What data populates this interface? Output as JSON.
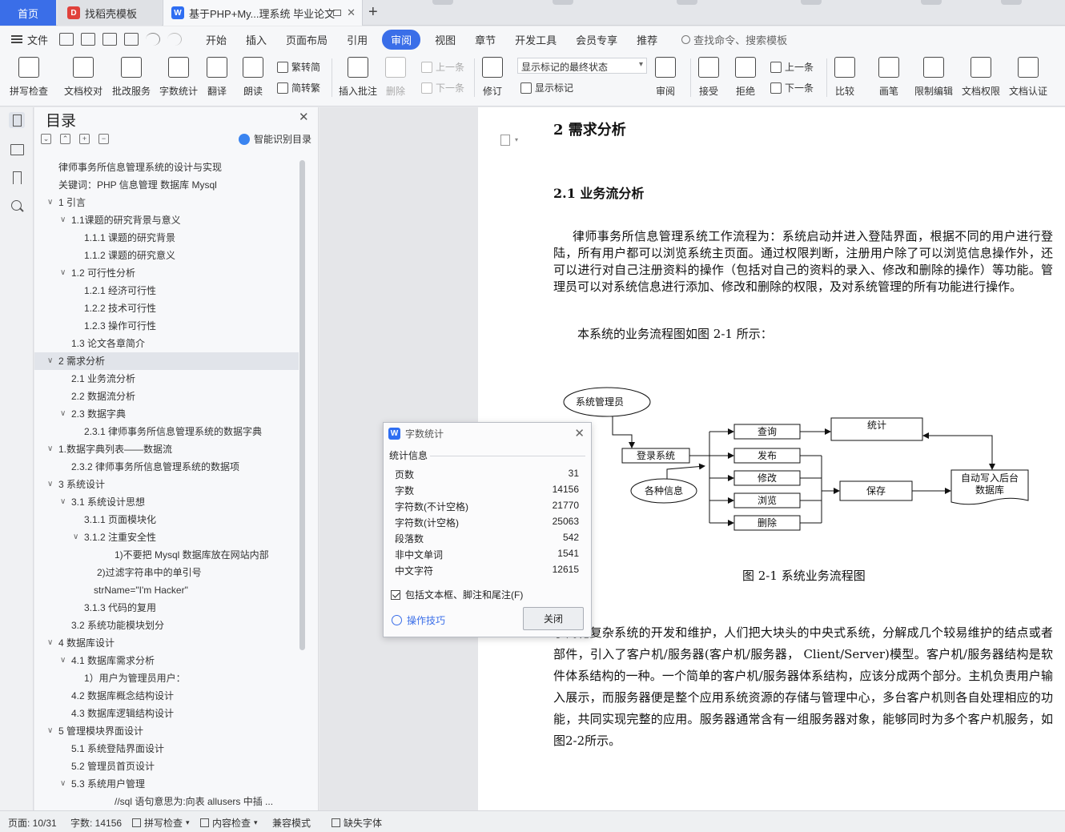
{
  "tabs": {
    "home": "首页",
    "daoke": "找稻壳模板",
    "doc": "基于PHP+My...理系统 毕业论文"
  },
  "menu": {
    "file": "文件",
    "items": [
      "开始",
      "插入",
      "页面布局",
      "引用",
      "审阅",
      "视图",
      "章节",
      "开发工具",
      "会员专享",
      "推荐"
    ],
    "active": "审阅",
    "search": "查找命令、搜索模板"
  },
  "ribbon": {
    "spell": "拼写检查",
    "proofread": "文档校对",
    "batch": "批改服务",
    "wordcount": "字数统计",
    "translate": "翻译",
    "read": "朗读",
    "to_trad": "繁转简",
    "to_simp": "简转繁",
    "insert_comment": "插入批注",
    "delete": "删除",
    "prev": "上一条",
    "next": "下一条",
    "revise": "修订",
    "markup_select": "显示标记的最终状态",
    "show_markup": "显示标记",
    "review": "审阅",
    "accept": "接受",
    "reject": "拒绝",
    "prev2": "上一条",
    "next2": "下一条",
    "compare": "比较",
    "pen": "画笔",
    "restrict": "限制编辑",
    "perm": "文档权限",
    "cert": "文档认证"
  },
  "toc": {
    "title": "目录",
    "smart": "智能识别目录",
    "items": [
      {
        "text": "律师事务所信息管理系统的设计与实现",
        "indent": 0,
        "arrow": ""
      },
      {
        "text": "关键词：PHP  信息管理  数据库  Mysql",
        "indent": 0,
        "arrow": ""
      },
      {
        "text": "1   引言",
        "indent": 0,
        "arrow": "v"
      },
      {
        "text": "1.1课题的研究背景与意义",
        "indent": 1,
        "arrow": "v"
      },
      {
        "text": "1.1.1    课题的研究背景",
        "indent": 2,
        "arrow": ""
      },
      {
        "text": "1.1.2    课题的研究意义",
        "indent": 2,
        "arrow": ""
      },
      {
        "text": "1.2    可行性分析",
        "indent": 1,
        "arrow": "v"
      },
      {
        "text": "1.2.1    经济可行性",
        "indent": 2,
        "arrow": ""
      },
      {
        "text": "1.2.2    技术可行性",
        "indent": 2,
        "arrow": ""
      },
      {
        "text": "1.2.3    操作可行性",
        "indent": 2,
        "arrow": ""
      },
      {
        "text": "1.3    论文各章简介",
        "indent": 1,
        "arrow": ""
      },
      {
        "text": "2   需求分析",
        "indent": 0,
        "arrow": "v",
        "selected": true
      },
      {
        "text": "2.1    业务流分析",
        "indent": 1,
        "arrow": ""
      },
      {
        "text": "2.2    数据流分析",
        "indent": 1,
        "arrow": ""
      },
      {
        "text": "2.3    数据字典",
        "indent": 1,
        "arrow": "v"
      },
      {
        "text": "2.3.1    律师事务所信息管理系统的数据字典",
        "indent": 2,
        "arrow": ""
      },
      {
        "text": "1.数据字典列表——数据流",
        "indent": 0,
        "arrow": "v"
      },
      {
        "text": "2.3.2    律师事务所信息管理系统的数据项",
        "indent": 1,
        "arrow": ""
      },
      {
        "text": "3    系统设计",
        "indent": 0,
        "arrow": "v"
      },
      {
        "text": "3.1    系统设计思想",
        "indent": 1,
        "arrow": "v"
      },
      {
        "text": "3.1.1    页面模块化",
        "indent": 2,
        "arrow": ""
      },
      {
        "text": "3.1.2    注重安全性",
        "indent": 2,
        "arrow": "v"
      },
      {
        "text": "1)不要把 Mysql 数据库放在网站内部",
        "indent": 4,
        "arrow": ""
      },
      {
        "text": "2)过滤字符串中的单引号",
        "indent": 3,
        "arrow": ""
      },
      {
        "text": "strName=\"I'm Hacker\"",
        "indent": 2.5,
        "arrow": ""
      },
      {
        "text": "3.1.3    代码的复用",
        "indent": 2,
        "arrow": ""
      },
      {
        "text": "3.2    系统功能模块划分",
        "indent": 1,
        "arrow": ""
      },
      {
        "text": "4    数据库设计",
        "indent": 0,
        "arrow": "v"
      },
      {
        "text": "4.1    数据库需求分析",
        "indent": 1,
        "arrow": "v"
      },
      {
        "text": "1）用户为管理员用户：",
        "indent": 2,
        "arrow": ""
      },
      {
        "text": "4.2    数据库概念结构设计",
        "indent": 1,
        "arrow": ""
      },
      {
        "text": "4.3    数据库逻辑结构设计",
        "indent": 1,
        "arrow": ""
      },
      {
        "text": "5    管理模块界面设计",
        "indent": 0,
        "arrow": "v"
      },
      {
        "text": "5.1  系统登陆界面设计",
        "indent": 1,
        "arrow": ""
      },
      {
        "text": "5.2    管理员首页设计",
        "indent": 1,
        "arrow": ""
      },
      {
        "text": "5.3    系统用户管理",
        "indent": 1,
        "arrow": "v"
      },
      {
        "text": "//sql 语句意思为:向表 allusers 中插 ...",
        "indent": 4,
        "arrow": ""
      }
    ]
  },
  "page": {
    "h2": "2    需求分析",
    "h3": "2.1    业务流分析",
    "p1": "律师事务所信息管理系统工作流程为：系统启动并进入登陆界面，根据不同的用户进行登陆，所有用户都可以浏览系统主页面。通过权限判断，注册用户除了可以浏览信息操作外，还可以进行对自己注册资料的操作（包括对自己的资料的录入、修改和删除的操作）等功能。管理员可以对系统信息进行添加、修改和删除的权限，及对系统管理的所有功能进行操作。",
    "p2": "本系统的业务流程图如图 2-1 所示：",
    "caption": "图 2-1    系统业务流程图",
    "p3": "了简化复杂系统的开发和维护，人们把大块头的中央式系统，分解成几个较易维护的结点或者部件，引入了客户机/服务器(客户机/服务器，  Client/Server)模型。客户机/服务器结构是软件体系结构的一种。一个简单的客户机/服务器体系结构，应该分成两个部分。主机负责用户输入展示，而服务器便是整个应用系统资源的存储与管理中心，多台客户机则各自处理相应的功能，共同实现完整的应用。服务器通常含有一组服务器对象，能够同时为多个客户机服务，如图2-2所示。",
    "diagram": {
      "admin": "系统管理员",
      "login": "登录系统",
      "info": "各种信息",
      "query": "查询",
      "publish": "发布",
      "modify": "修改",
      "browse": "浏览",
      "delete": "删除",
      "stats": "统计",
      "save": "保存",
      "db_line1": "自动写入后台",
      "db_line2": "数据库"
    }
  },
  "dialog": {
    "title": "字数统计",
    "section": "统计信息",
    "rows": [
      {
        "k": "页数",
        "v": "31"
      },
      {
        "k": "字数",
        "v": "14156"
      },
      {
        "k": "字符数(不计空格)",
        "v": "21770"
      },
      {
        "k": "字符数(计空格)",
        "v": "25063"
      },
      {
        "k": "段落数",
        "v": "542"
      },
      {
        "k": "非中文单词",
        "v": "1541"
      },
      {
        "k": "中文字符",
        "v": "12615"
      }
    ],
    "checkbox": "包括文本框、脚注和尾注(F)",
    "tip": "操作技巧",
    "close": "关闭"
  },
  "status": {
    "page": "页面: 10/31",
    "words": "字数: 14156",
    "spell": "拼写检查",
    "content": "内容检查",
    "compat": "兼容模式",
    "font": "缺失字体"
  }
}
